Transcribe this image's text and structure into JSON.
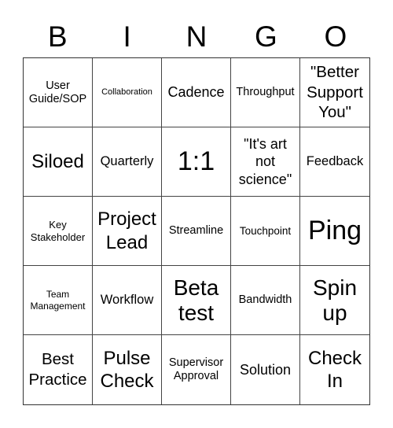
{
  "header": {
    "letters": [
      "B",
      "I",
      "N",
      "G",
      "O"
    ]
  },
  "cells": [
    "User Guide/SOP",
    "Collaboration",
    "Cadence",
    "Throughput",
    "\"Better Support You\"",
    "Siloed",
    "Quarterly",
    "1:1",
    "\"It's art not science\"",
    "Feedback",
    "Key Stakeholder",
    "Project Lead",
    "Streamline",
    "Touchpoint",
    "Ping",
    "Team Management",
    "Workflow",
    "Beta test",
    "Bandwidth",
    "Spin up",
    "Best Practice",
    "Pulse Check",
    "Supervisor Approval",
    "Solution",
    "Check In"
  ]
}
